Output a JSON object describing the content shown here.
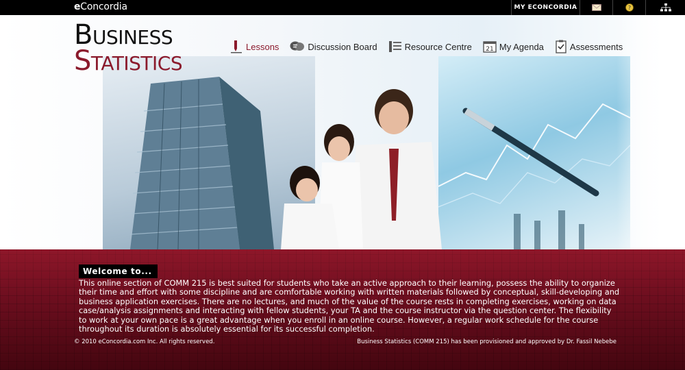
{
  "topbar": {
    "brand_prefix": "e",
    "brand_name": "Concordia",
    "my_link": "MY ECONCORDIA",
    "icons": [
      "mail-icon",
      "help-icon",
      "sitemap-icon"
    ]
  },
  "logo": {
    "line1_cap": "B",
    "line1_rest": "USINESS",
    "line2_cap": "S",
    "line2_rest": "TATISTICS"
  },
  "nav": {
    "items": [
      {
        "label": "Lessons",
        "icon": "pen-icon",
        "active": true
      },
      {
        "label": "Discussion Board",
        "icon": "chat-bubbles-icon",
        "active": false
      },
      {
        "label": "Resource Centre",
        "icon": "list-icon",
        "active": false
      },
      {
        "label": "My Agenda",
        "icon": "calendar-icon",
        "active": false,
        "calendar_day": "21"
      },
      {
        "label": "Assessments",
        "icon": "checklist-icon",
        "active": false
      }
    ]
  },
  "welcome": {
    "heading": "Welcome to...",
    "body": "This online section of COMM 215 is best suited for students who take an active approach to their learning, possess the ability to organize their time and effort with some discipline and are comfortable working with written materials followed by conceptual, skill-developing and business application exercises. There are no lectures, and much of the value of the course rests in completing exercises, working on data case/analysis assignments and interacting with fellow students, your TA and the course instructor via the question center. The flexibility to work at your own pace is a great advantage when you enroll in an online course. However, a regular work schedule for the course throughout its duration is absolutely essential for its successful completion."
  },
  "footer": {
    "copyright": "© 2010 eConcordia.com Inc. All rights reserved.",
    "approval": "Business Statistics (COMM 215) has been provisioned and approved by Dr. Fassil Nebebe"
  },
  "colors": {
    "accent": "#8b1a2c",
    "background_bottom": "#6d0e1f"
  }
}
